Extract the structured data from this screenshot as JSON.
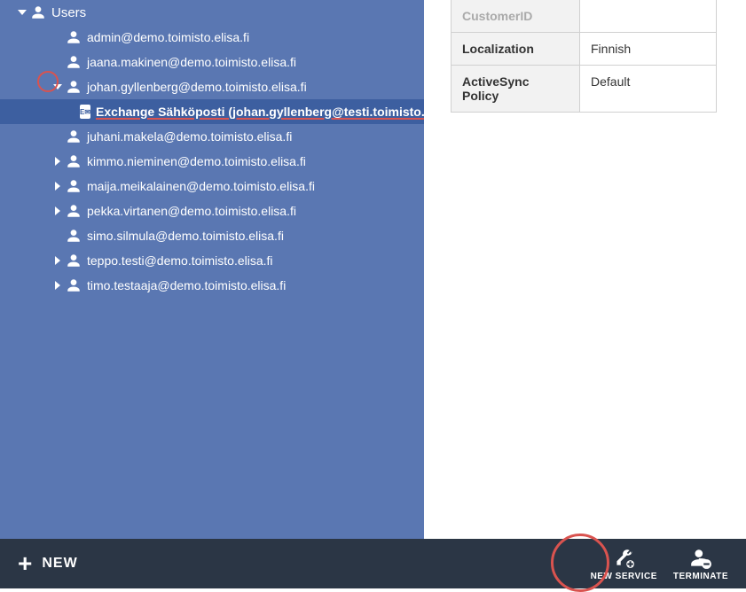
{
  "tree": {
    "root_label": "Users",
    "items": [
      {
        "label": "admin@demo.toimisto.elisa.fi",
        "expandable": false,
        "expanded": false,
        "children": []
      },
      {
        "label": "jaana.makinen@demo.toimisto.elisa.fi",
        "expandable": false,
        "expanded": false,
        "children": []
      },
      {
        "label": "johan.gyllenberg@demo.toimisto.elisa.fi",
        "expandable": true,
        "expanded": true,
        "children": [
          {
            "label": "Exchange Sähköposti (johan.gyllenberg@testi.toimisto.elisa.fi)",
            "selected": true,
            "ex": true
          }
        ]
      },
      {
        "label": "juhani.makela@demo.toimisto.elisa.fi",
        "expandable": false,
        "expanded": false,
        "children": []
      },
      {
        "label": "kimmo.nieminen@demo.toimisto.elisa.fi",
        "expandable": true,
        "expanded": false,
        "children": []
      },
      {
        "label": "maija.meikalainen@demo.toimisto.elisa.fi",
        "expandable": true,
        "expanded": false,
        "children": []
      },
      {
        "label": "pekka.virtanen@demo.toimisto.elisa.fi",
        "expandable": true,
        "expanded": false,
        "children": []
      },
      {
        "label": "simo.silmula@demo.toimisto.elisa.fi",
        "expandable": false,
        "expanded": false,
        "children": []
      },
      {
        "label": "teppo.testi@demo.toimisto.elisa.fi",
        "expandable": true,
        "expanded": false,
        "children": []
      },
      {
        "label": "timo.testaaja@demo.toimisto.elisa.fi",
        "expandable": true,
        "expanded": false,
        "children": []
      }
    ]
  },
  "details": {
    "rows": [
      {
        "key": "CustomerID",
        "value": ""
      },
      {
        "key": "Localization",
        "value": "Finnish"
      },
      {
        "key": "ActiveSync Policy",
        "value": "Default"
      }
    ]
  },
  "bottom": {
    "new_label": "NEW",
    "new_service_label": "NEW SERVICE",
    "terminate_label": "TERMINATE"
  }
}
